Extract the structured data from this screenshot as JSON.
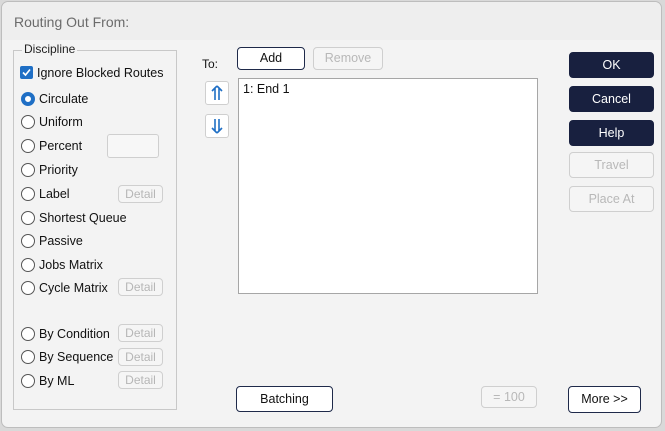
{
  "window": {
    "title": "Routing Out From:"
  },
  "discipline": {
    "legend": "Discipline",
    "ignore_blocked": {
      "label": "Ignore Blocked Routes",
      "checked": true
    },
    "options": [
      {
        "label": "Circulate",
        "selected": true
      },
      {
        "label": "Uniform"
      },
      {
        "label": "Percent"
      },
      {
        "label": "Priority"
      },
      {
        "label": "Label",
        "detail": "Detail"
      },
      {
        "label": "Shortest Queue"
      },
      {
        "label": "Passive"
      },
      {
        "label": "Jobs Matrix"
      },
      {
        "label": "Cycle Matrix",
        "detail": "Detail"
      },
      {
        "label": "By Condition",
        "detail": "Detail"
      },
      {
        "label": "By Sequence",
        "detail": "Detail"
      },
      {
        "label": "By ML",
        "detail": "Detail"
      }
    ]
  },
  "to": {
    "label": "To:",
    "add": "Add",
    "remove": "Remove",
    "items": [
      "1: End 1"
    ]
  },
  "buttons": {
    "ok": "OK",
    "cancel": "Cancel",
    "help": "Help",
    "travel": "Travel",
    "place_at": "Place At",
    "batching": "Batching",
    "eq100": "= 100",
    "more": "More >>"
  },
  "colors": {
    "accent": "#1f6fc5",
    "dark_button": "#18203f"
  }
}
